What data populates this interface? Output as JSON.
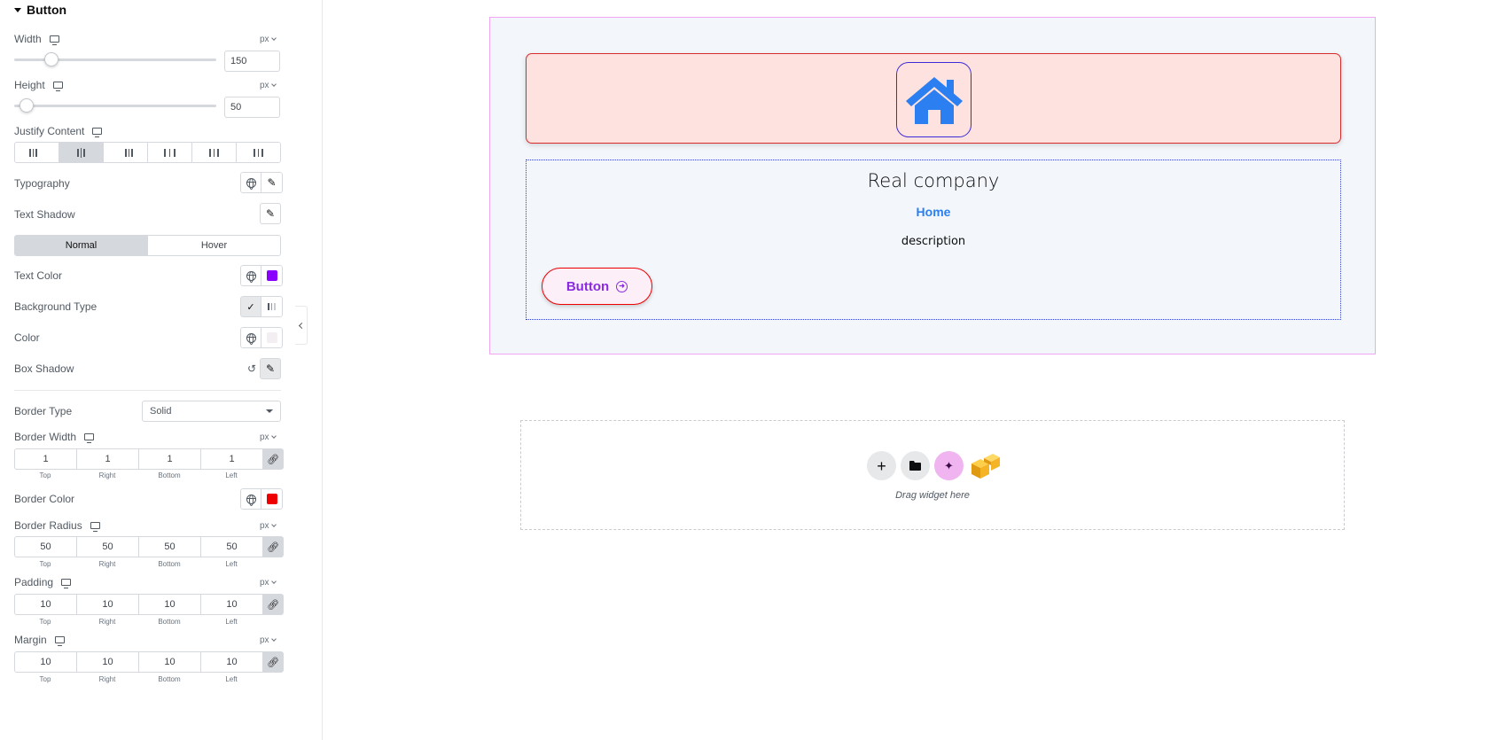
{
  "panel": {
    "section_title": "Button",
    "width": {
      "label": "Width",
      "unit": "px",
      "value": "150",
      "slider_fraction": 0.19
    },
    "height": {
      "label": "Height",
      "unit": "px",
      "value": "50",
      "slider_fraction": 0.06
    },
    "justify_content": {
      "label": "Justify Content",
      "options": [
        "start",
        "center",
        "end",
        "space-between",
        "space-around",
        "space-evenly"
      ],
      "selected": "center"
    },
    "typography": {
      "label": "Typography"
    },
    "text_shadow": {
      "label": "Text Shadow"
    },
    "state_tabs": {
      "normal": "Normal",
      "hover": "Hover",
      "active": "Normal"
    },
    "text_color": {
      "label": "Text Color",
      "swatch": "#8a00ff"
    },
    "background_type": {
      "label": "Background Type",
      "selected": "classic"
    },
    "color": {
      "label": "Color",
      "swatch": "#f2eef2"
    },
    "box_shadow": {
      "label": "Box Shadow"
    },
    "border_type": {
      "label": "Border Type",
      "value": "Solid"
    },
    "border_width": {
      "label": "Border Width",
      "unit": "px",
      "top": "1",
      "right": "1",
      "bottom": "1",
      "left": "1"
    },
    "border_color": {
      "label": "Border Color",
      "swatch": "#ee0000"
    },
    "border_radius": {
      "label": "Border Radius",
      "unit": "px",
      "top": "50",
      "right": "50",
      "bottom": "50",
      "left": "50"
    },
    "padding": {
      "label": "Padding",
      "unit": "px",
      "top": "10",
      "right": "10",
      "bottom": "10",
      "left": "10"
    },
    "margin": {
      "label": "Margin",
      "unit": "px",
      "top": "10",
      "right": "10",
      "bottom": "10",
      "left": "10"
    },
    "dim_labels": {
      "top": "Top",
      "right": "Right",
      "bottom": "Bottom",
      "left": "Left"
    }
  },
  "canvas": {
    "heading": "Real company",
    "link": "Home",
    "description": "description",
    "button_label": "Button",
    "icon": "house-icon",
    "drop_label": "Drag widget here"
  },
  "colors": {
    "accent_link": "#2b7ff0",
    "button_text": "#8a2be2",
    "button_border": "#ee0000",
    "icon": "#2b7ff0"
  }
}
